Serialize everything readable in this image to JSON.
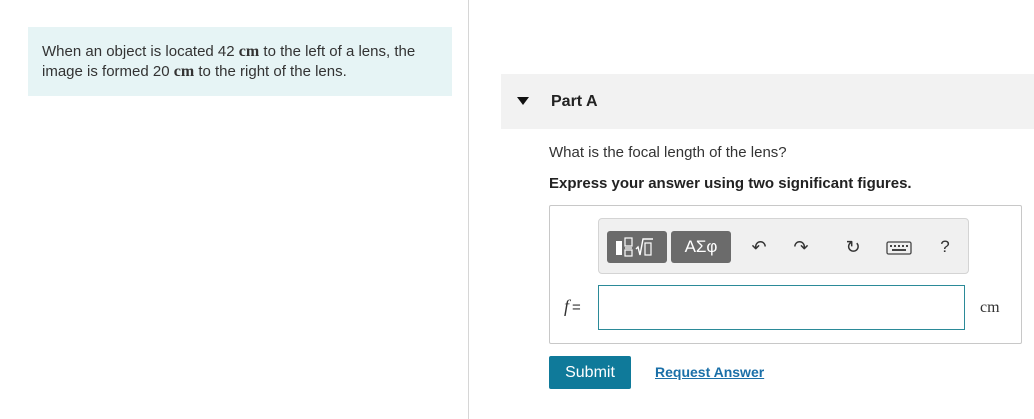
{
  "problem": {
    "line1_pre": "When an object is located 42 ",
    "line1_unit": "cm",
    "line1_post": " to the left of a lens, the",
    "line2_pre": "image is formed 20 ",
    "line2_unit": "cm",
    "line2_post": " to the right of the lens."
  },
  "part": {
    "title": "Part A",
    "question": "What is the focal length of the lens?",
    "instruction": "Express your answer using two significant figures."
  },
  "toolbar": {
    "greek_label": "ΑΣφ",
    "undo_icon": "↶",
    "redo_icon": "↷",
    "reset_icon": "↻",
    "help_label": "?"
  },
  "answer": {
    "variable": "f",
    "equals": "=",
    "value": "",
    "unit": "cm"
  },
  "actions": {
    "submit_label": "Submit",
    "request_label": "Request Answer"
  },
  "colors": {
    "problem_bg": "#e6f4f5",
    "submit_bg": "#0f7a9a",
    "link": "#1a6fa8",
    "input_border": "#2b8a98"
  }
}
